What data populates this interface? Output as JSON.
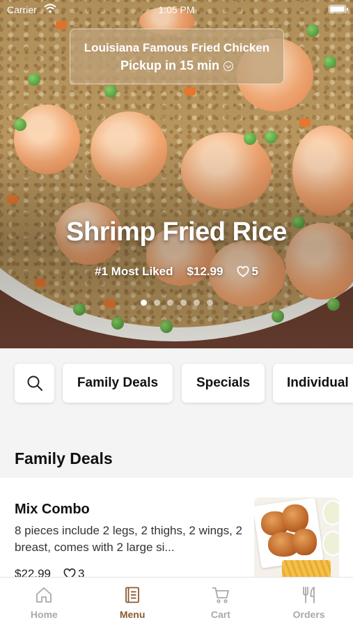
{
  "status_bar": {
    "carrier": "Carrier",
    "time": "1:05 PM"
  },
  "store": {
    "name": "Louisiana Famous Fried Chicken",
    "pickup": "Pickup in 15 min"
  },
  "featured": {
    "title": "Shrimp Fried Rice",
    "badge": "#1 Most Liked",
    "price": "$12.99",
    "likes": "5",
    "carousel_pages": 6,
    "carousel_active": 1
  },
  "categories": {
    "search_icon": "search-icon",
    "items": [
      "Family Deals",
      "Specials",
      "Individual"
    ]
  },
  "section": {
    "title": "Family Deals"
  },
  "menu_item": {
    "name": "Mix Combo",
    "description": "8 pieces include 2 legs, 2 thighs, 2 wings, 2 breast, comes with 2 large si...",
    "price": "$22.99",
    "likes": "3"
  },
  "tabs": [
    {
      "label": "Home",
      "icon": "home-icon",
      "active": false
    },
    {
      "label": "Menu",
      "icon": "menu-book-icon",
      "active": true
    },
    {
      "label": "Cart",
      "icon": "cart-icon",
      "active": false
    },
    {
      "label": "Orders",
      "icon": "fork-knife-icon",
      "active": false
    }
  ],
  "colors": {
    "accent": "#8b5a32",
    "inactive_tab": "#a9a9a9"
  }
}
